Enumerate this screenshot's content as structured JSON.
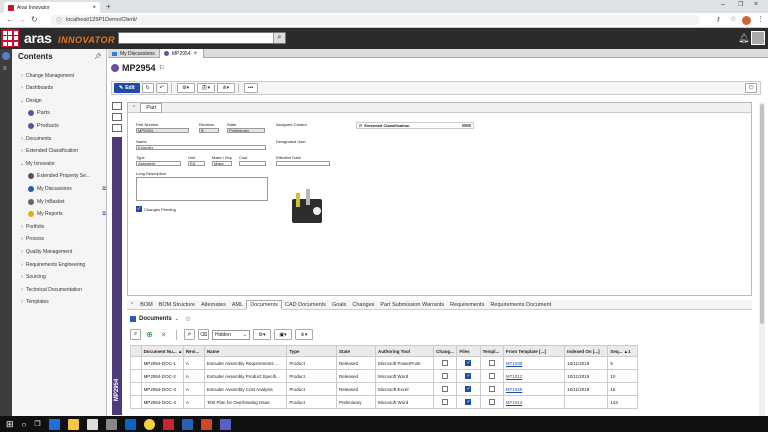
{
  "browser": {
    "tab_title": "Aras Innovator",
    "url": "localhost/125P1Demo/Client/"
  },
  "header": {
    "logo_main": "aras",
    "logo_sub": "INNOVATOR"
  },
  "sidebar": {
    "title": "Contents",
    "items": [
      {
        "label": "Change Management",
        "chev": "›"
      },
      {
        "label": "Dashboards",
        "chev": "›"
      },
      {
        "label": "Design",
        "chev": "⌄"
      },
      {
        "label": "Parts",
        "chev": ""
      },
      {
        "label": "Products",
        "chev": ""
      },
      {
        "label": "Documents",
        "chev": "›"
      },
      {
        "label": "Extended Classification",
        "chev": "›"
      },
      {
        "label": "My Innovator",
        "chev": "⌄"
      },
      {
        "label": "Extended Property Se...",
        "chev": ""
      },
      {
        "label": "My Discussions",
        "chev": ""
      },
      {
        "label": "My InBasket",
        "chev": ""
      },
      {
        "label": "My Reports",
        "chev": ""
      },
      {
        "label": "Portfolio",
        "chev": "›"
      },
      {
        "label": "Process",
        "chev": "›"
      },
      {
        "label": "Quality Management",
        "chev": "›"
      },
      {
        "label": "Requirements Engineering",
        "chev": "›"
      },
      {
        "label": "Sourcing",
        "chev": "›"
      },
      {
        "label": "Technical Documentation",
        "chev": "›"
      },
      {
        "label": "Templates",
        "chev": "›"
      }
    ]
  },
  "doc_tabs": [
    {
      "label": "My Discussions"
    },
    {
      "label": "MP2954"
    }
  ],
  "item": {
    "title": "MP2954",
    "edit_label": "Edit",
    "part_tab": "Part",
    "vertical_label": "MP2954"
  },
  "form": {
    "part_number_label": "Part Number",
    "part_number": "MP2954",
    "revision_label": "Revision",
    "revision": "B",
    "state_label": "State",
    "state": "Preliminary",
    "assigned_creator_label": "Assigned Creator",
    "extended_classification_label": "Extended Classification",
    "name_label": "Name",
    "name": "Extruder",
    "designated_user_label": "Designated User",
    "type_label": "Type",
    "type": "Assembly",
    "unit_label": "Unit",
    "unit": "EA",
    "make_buy_label": "Make / Buy",
    "make_buy": "Make",
    "cost_label": "Cost",
    "effective_date_label": "Effective Date",
    "long_description_label": "Long Description",
    "changes_pending_label": "Changes Pending"
  },
  "relationship_tabs": [
    "BOM",
    "BOM Structure",
    "Alternates",
    "AML",
    "Documents",
    "CAD Documents",
    "Goals",
    "Changes",
    "Part Submission Warrants",
    "Requirements",
    "Requirements Document"
  ],
  "active_rel_tab": "Documents",
  "documents": {
    "section_label": "Documents",
    "hidden_select": "Hidden",
    "columns": [
      "Document Nu... ▲1",
      "Revi...",
      "Name",
      "Type",
      "State",
      "Authoring Tool",
      "Chang...",
      "Files",
      "Templ...",
      "From Template [...]",
      "Indexed On [...]",
      "Seq... ▲1"
    ],
    "rows": [
      {
        "number": "MP2954-DOC-1",
        "rev": "A",
        "name": "Extruder Assembly Requirements ...",
        "type": "Product",
        "state": "Released",
        "tool": "Microsoft PowerPoint",
        "changes": false,
        "files": true,
        "template": false,
        "from_template": "MT1039",
        "indexed": "10/11/2019",
        "seq": "5"
      },
      {
        "number": "MP2954-DOC-2",
        "rev": "A",
        "name": "Extruder Assembly Product Specifi...",
        "type": "Product",
        "state": "Released",
        "tool": "Microsoft Word",
        "changes": false,
        "files": true,
        "template": false,
        "from_template": "MT1012",
        "indexed": "10/11/2019",
        "seq": "10"
      },
      {
        "number": "MP2954-DOC-3",
        "rev": "A",
        "name": "Extruder Assembly Cost Analysis",
        "type": "Product",
        "state": "Released",
        "tool": "Microsoft Excel",
        "changes": false,
        "files": true,
        "template": false,
        "from_template": "MT1025",
        "indexed": "10/11/2019",
        "seq": "15"
      },
      {
        "number": "MP2954-DOC-4",
        "rev": "A",
        "name": "Test Plan for Overheating Issue",
        "type": "Product",
        "state": "Preliminary",
        "tool": "Microsoft Word",
        "changes": false,
        "files": true,
        "template": false,
        "from_template": "MT1014",
        "indexed": "",
        "seq": "143"
      }
    ]
  },
  "colors": {
    "accent": "#1e4ba8",
    "brand_red": "#c8102e",
    "brand_orange": "#e87722",
    "purple": "#503b7a"
  }
}
